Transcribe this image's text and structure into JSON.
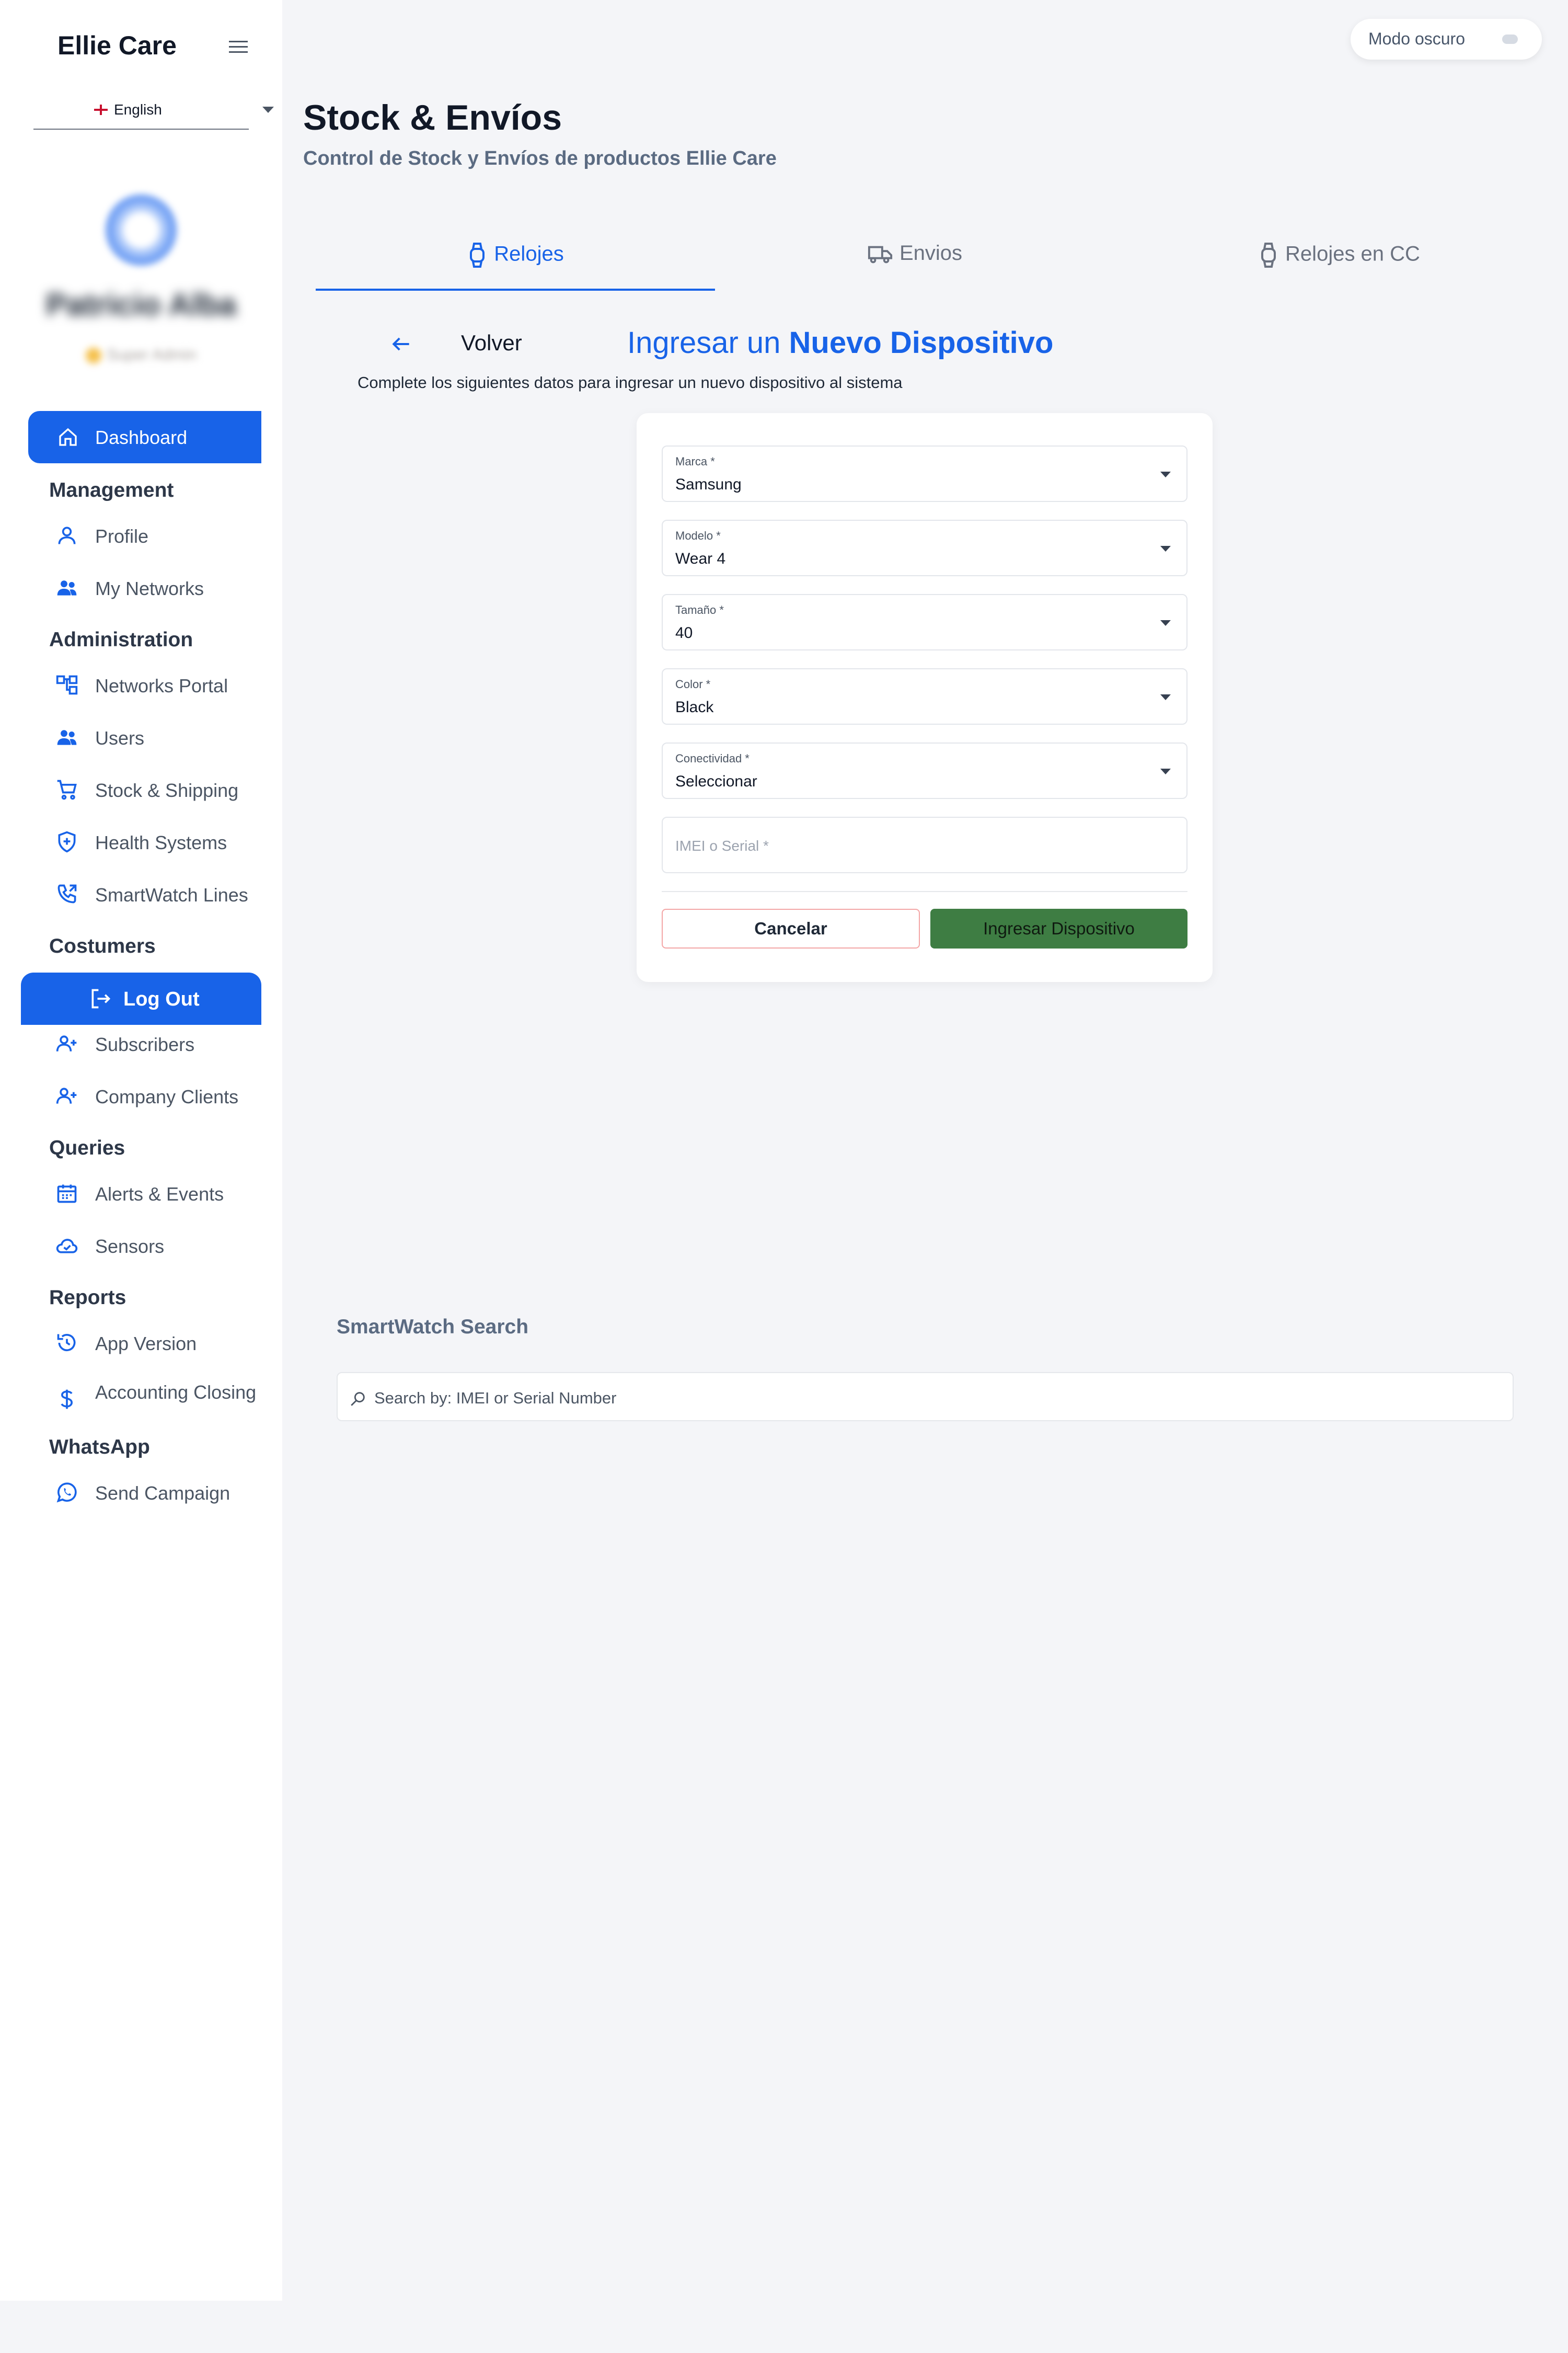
{
  "sidebar": {
    "brand": "Ellie Care",
    "language": "English",
    "user_name": "Patricio Alba",
    "user_role": "Super Admin",
    "active_item": "Dashboard",
    "logout_label": "Log Out",
    "sections": [
      {
        "title": "Management",
        "items": [
          "Profile",
          "My Networks"
        ]
      },
      {
        "title": "Administration",
        "items": [
          "Networks Portal",
          "Users",
          "Stock & Shipping",
          "Health Systems",
          "SmartWatch Lines"
        ]
      },
      {
        "title": "Costumers",
        "items": [
          "Subscribers",
          "Company Clients"
        ]
      },
      {
        "title": "Queries",
        "items": [
          "Alerts & Events",
          "Sensors"
        ]
      },
      {
        "title": "Reports",
        "items": [
          "App Version",
          "Accounting Closing"
        ]
      },
      {
        "title": "WhatsApp",
        "items": [
          "Send Campaign"
        ]
      }
    ]
  },
  "topbar": {
    "dark_mode_label": "Modo oscuro"
  },
  "header": {
    "title": "Stock & Envíos",
    "subtitle": "Control de Stock y Envíos de productos Ellie Care"
  },
  "tabs": [
    {
      "label": "Relojes",
      "icon": "watch-icon",
      "active": true
    },
    {
      "label": "Envios",
      "icon": "truck-icon",
      "active": false
    },
    {
      "label": "Relojes en CC",
      "icon": "watch-icon",
      "active": false
    }
  ],
  "form": {
    "back_label": "Volver",
    "title_prefix": "Ingresar un ",
    "title_strong": "Nuevo Dispositivo",
    "description": "Complete los siguientes datos para ingresar un nuevo dispositivo al sistema",
    "fields": [
      {
        "label": "Marca *",
        "value": "Samsung"
      },
      {
        "label": "Modelo *",
        "value": "Wear 4"
      },
      {
        "label": "Tamaño *",
        "value": "40"
      },
      {
        "label": "Color *",
        "value": "Black"
      },
      {
        "label": "Conectividad *",
        "value": "Seleccionar"
      }
    ],
    "imei_placeholder": "IMEI o Serial *",
    "cancel_label": "Cancelar",
    "submit_label": "Ingresar Dispositivo"
  },
  "search": {
    "title": "SmartWatch Search",
    "placeholder": "Search by: IMEI or Serial Number"
  },
  "colors": {
    "primary": "#1863e8",
    "submit": "#3e7d43",
    "cancel_border": "#f3a6a6",
    "background": "#f4f5f8"
  }
}
